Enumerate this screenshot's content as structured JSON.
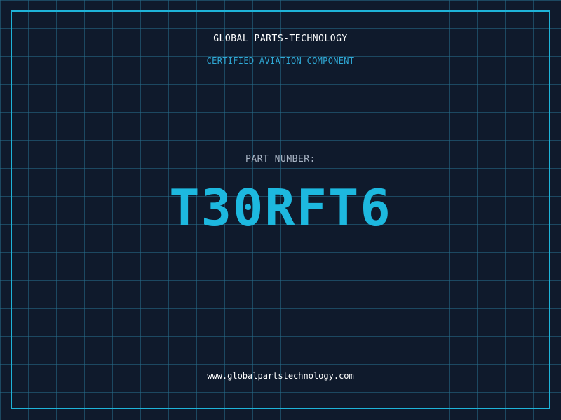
{
  "header": {
    "company": "GLOBAL PARTS-TECHNOLOGY",
    "subtitle": "CERTIFIED AVIATION COMPONENT"
  },
  "part": {
    "label": "PART NUMBER:",
    "number": "T30RFT6"
  },
  "footer": {
    "url": "www.globalpartstechnology.com"
  },
  "colors": {
    "background": "#0f1a2c",
    "grid": "#266e8c",
    "border": "#1eb3d8",
    "accent": "#1db8df",
    "subtitle": "#2fa9d6",
    "label": "#a8b4c4",
    "text": "#ffffff"
  }
}
